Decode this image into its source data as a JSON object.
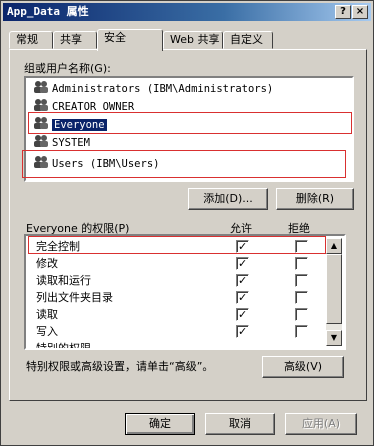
{
  "window": {
    "title": "App_Data 属性",
    "help_label": "?",
    "close_label": "×"
  },
  "tabs": [
    {
      "label": "常规"
    },
    {
      "label": "共享"
    },
    {
      "label": "安全"
    },
    {
      "label": "Web 共享"
    },
    {
      "label": "自定义"
    }
  ],
  "users_section": {
    "label": "组或用户名称(G):",
    "items": [
      {
        "name": "Administrators (IBM\\Administrators)",
        "selected": false
      },
      {
        "name": "CREATOR OWNER",
        "selected": false
      },
      {
        "name": "Everyone",
        "selected": true
      },
      {
        "name": "SYSTEM",
        "selected": false
      },
      {
        "name": "Users (IBM\\Users)",
        "selected": false
      }
    ],
    "add_label": "添加(D)...",
    "remove_label": "删除(R)"
  },
  "permissions": {
    "label": "Everyone 的权限(P)",
    "allow_header": "允许",
    "deny_header": "拒绝",
    "rows": [
      {
        "name": "完全控制",
        "allow": true,
        "deny": false
      },
      {
        "name": "修改",
        "allow": true,
        "deny": false
      },
      {
        "name": "读取和运行",
        "allow": true,
        "deny": false
      },
      {
        "name": "列出文件夹目录",
        "allow": true,
        "deny": false
      },
      {
        "name": "读取",
        "allow": true,
        "deny": false
      },
      {
        "name": "写入",
        "allow": true,
        "deny": false
      },
      {
        "name": "特别的权限",
        "allow": false,
        "deny": false
      }
    ]
  },
  "advanced": {
    "note": "特别权限或高级设置，请单击“高级”。",
    "button_label": "高级(V)"
  },
  "footer": {
    "ok_label": "确定",
    "cancel_label": "取消",
    "apply_label": "应用(A)"
  },
  "colors": {
    "highlight": "#0a246a",
    "annotation": "#d93030"
  }
}
